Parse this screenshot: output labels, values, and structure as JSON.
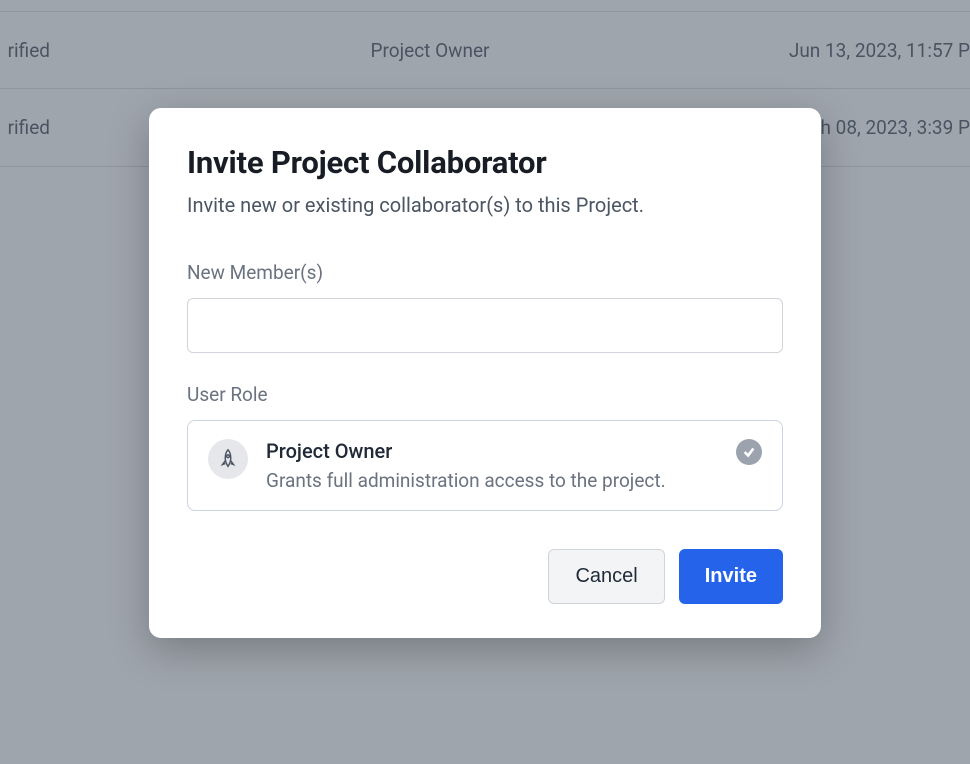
{
  "background": {
    "rows": [
      {
        "status": "rified",
        "role": "Project Owner",
        "date": "Jun 13, 2023, 11:57 P"
      },
      {
        "status": "rified",
        "role": "",
        "date": "h 08, 2023, 3:39 P"
      }
    ]
  },
  "modal": {
    "title": "Invite Project Collaborator",
    "subtitle": "Invite new or existing collaborator(s) to this Project.",
    "new_members_label": "New Member(s)",
    "new_members_value": "",
    "user_role_label": "User Role",
    "role": {
      "name": "Project Owner",
      "description": "Grants full administration access to the project.",
      "selected": true
    },
    "buttons": {
      "cancel": "Cancel",
      "invite": "Invite"
    }
  }
}
